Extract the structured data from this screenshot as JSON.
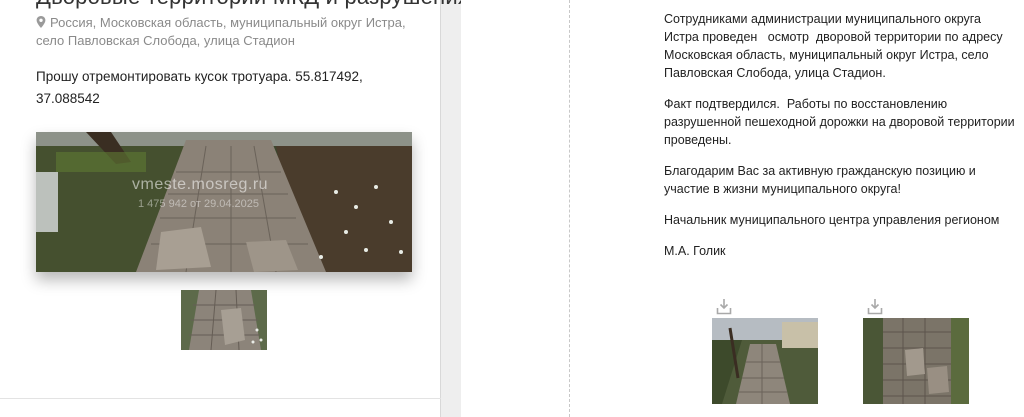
{
  "left": {
    "title": "Дворовые территории МКД и разрушения",
    "address": "Россия, Московская область, муниципальный округ Истра, село Павловская Слобода, улица Стадион",
    "address_icon": "map-pin-icon",
    "request_text": "Прошу отремонтировать кусок тротуара. 55.817492, 37.088542",
    "watermark": "vmeste.mosreg.ru",
    "watermark_sub": "1 475 942 от 29.04.2025"
  },
  "right": {
    "paragraphs": [
      "Сотрудниками администрации муниципального округа Истра проведен   осмотр  дворовой территории по адресу  Московская область, муниципальный округ Истра, село Павловская Слобода, улица Стадион.",
      "Факт подтвердился.  Работы по восстановлению разрушенной пешеходной дорожки на дворовой территории проведены.",
      "Благодарим Вас за активную гражданскую позицию и участие в жизни муниципального округа!",
      "Начальник муниципального центра управления регионом",
      "М.А. Голик"
    ],
    "attachments": [
      {
        "icon": "download-icon"
      },
      {
        "icon": "download-icon"
      }
    ]
  },
  "colors": {
    "background": "#eeeeee",
    "panel": "#ffffff",
    "muted_text": "#8a8a8a",
    "body_text": "#222222"
  }
}
